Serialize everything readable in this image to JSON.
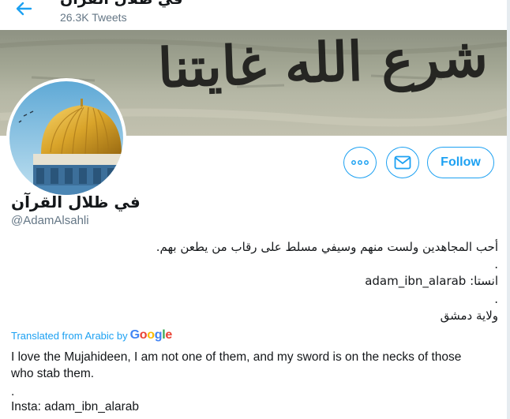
{
  "header": {
    "title": "في ظلال القرآن",
    "tweet_count": "26.3K Tweets"
  },
  "banner": {
    "text": "شرع الله غايتنا"
  },
  "actions": {
    "follow_label": "Follow"
  },
  "profile": {
    "display_name": "في ظلال القرآن",
    "handle": "@AdamAlsahli"
  },
  "bio_arabic": {
    "line1": "أحب المجاهدين ولست منهم وسيفي مسلط على رقاب من يطعن بهم.",
    "line2": ".",
    "line3": "انستا: adam_ibn_alarab",
    "line4": ".",
    "line5": "ولاية دمشق"
  },
  "translation": {
    "prefix": "Translated from Arabic by",
    "provider": "Google",
    "line1": "I love the Mujahideen, I am not one of them, and my sword is on the necks of those who stab them.",
    "line2": ".",
    "line3": "Insta: adam_ibn_alarab"
  },
  "colors": {
    "accent": "#1da1f2",
    "secondary_text": "#657786"
  }
}
